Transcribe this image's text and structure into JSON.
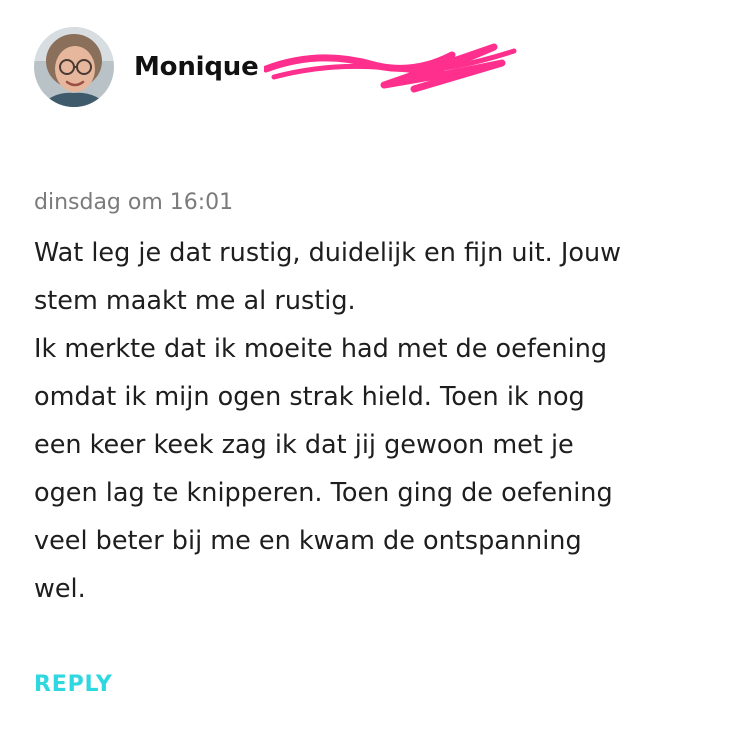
{
  "comment": {
    "author": {
      "name": "Monique",
      "avatar_icon": "user-photo-avatar"
    },
    "redaction_icon": "pink-scribble-redaction",
    "redaction_color": "#ff2f8d",
    "timestamp": "dinsdag om 16:01",
    "message_lines": [
      "Wat leg je dat rustig, duidelijk en fijn uit. Jouw",
      "stem maakt me al rustig.",
      "Ik merkte dat ik moeite had met de oefening",
      "omdat ik mijn ogen strak hield. Toen ik nog",
      "een keer keek zag ik dat jij gewoon met je",
      "ogen lag te knipperen. Toen ging de oefening",
      "veel beter bij me en kwam de ontspanning",
      "wel."
    ],
    "reply_label": "REPLY",
    "reply_color": "#2fd7e0"
  }
}
